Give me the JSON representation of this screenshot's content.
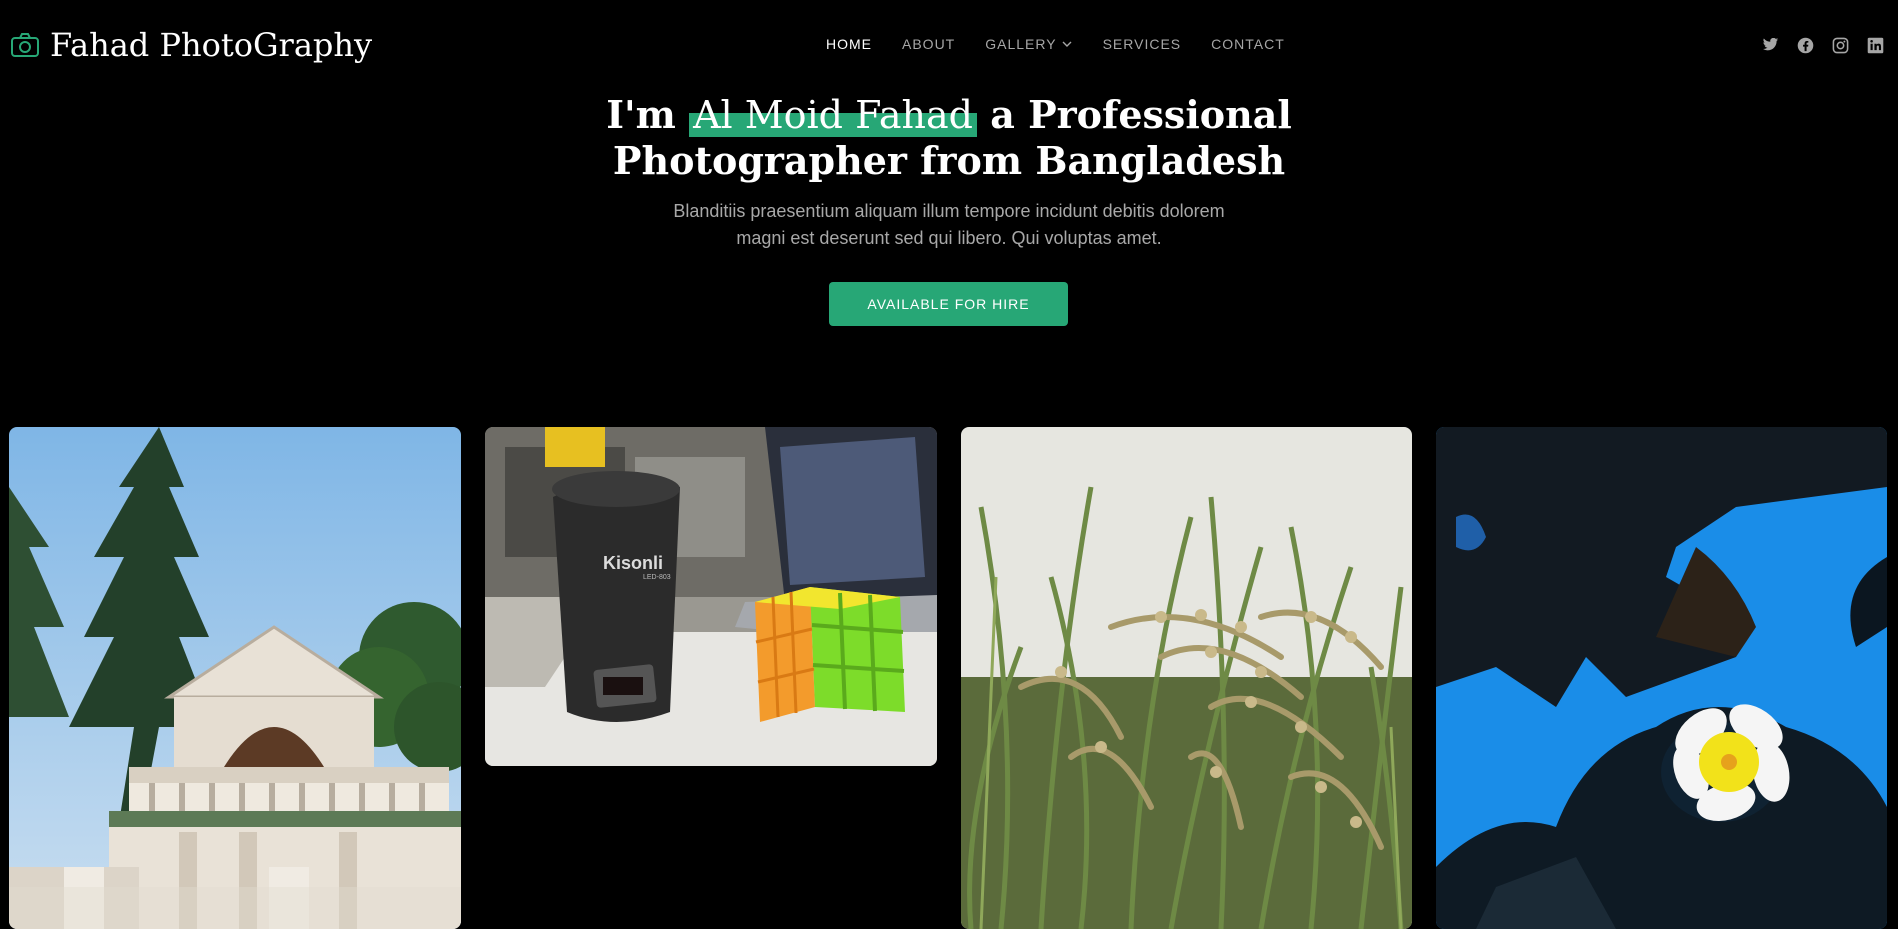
{
  "brand": {
    "name": "Fahad PhotoGraphy",
    "icon": "camera-icon",
    "accent": "#27a776"
  },
  "nav": {
    "items": [
      {
        "label": "HOME",
        "active": true
      },
      {
        "label": "ABOUT",
        "active": false
      },
      {
        "label": "GALLERY",
        "active": false,
        "dropdown": true
      },
      {
        "label": "SERVICES",
        "active": false
      },
      {
        "label": "CONTACT",
        "active": false
      }
    ]
  },
  "social": [
    "twitter-icon",
    "facebook-icon",
    "instagram-icon",
    "linkedin-icon"
  ],
  "hero": {
    "title_prefix": "I'm ",
    "title_highlight": "Al Moid Fahad",
    "title_suffix": " a Professional",
    "title_line2": "Photographer from Bangladesh",
    "subtitle_line1": "Blanditiis praesentium aliquam illum tempore incidunt debitis dolorem",
    "subtitle_line2": "magni est deserunt sed qui libero. Qui voluptas amet.",
    "cta_label": "AVAILABLE FOR HIRE"
  },
  "gallery": {
    "items": [
      {
        "subject": "house-and-trees-photo"
      },
      {
        "subject": "speaker-and-cube-photo",
        "speaker_brand": "Kisonli",
        "speaker_model": "LED-803"
      },
      {
        "subject": "rice-field-photo"
      },
      {
        "subject": "flower-on-water-photo"
      }
    ]
  }
}
